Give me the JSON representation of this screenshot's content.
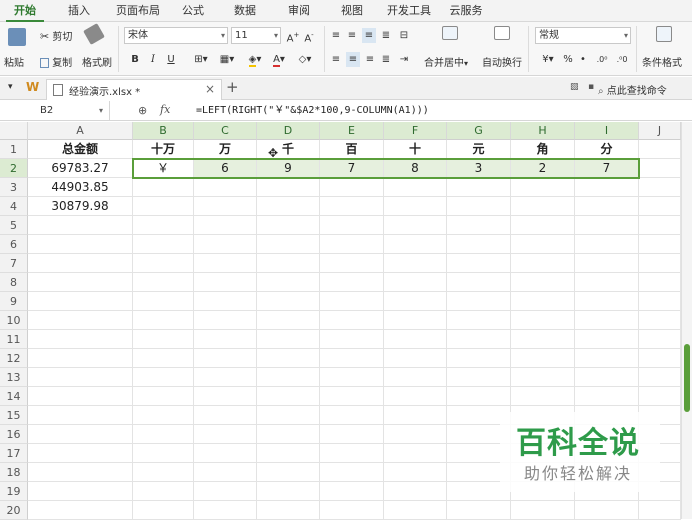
{
  "menu": {
    "tabs": [
      {
        "label": "开始",
        "active": true
      },
      {
        "label": "插入"
      },
      {
        "label": "页面布局"
      },
      {
        "label": "公式"
      },
      {
        "label": "数据"
      },
      {
        "label": "审阅"
      },
      {
        "label": "视图"
      },
      {
        "label": "开发工具"
      },
      {
        "label": "云服务"
      }
    ]
  },
  "ribbon": {
    "paste": "粘贴",
    "cut": "剪切",
    "copy": "复制",
    "format_painter": "格式刷",
    "font_name": "宋体",
    "font_size": "11",
    "bold": "B",
    "italic": "I",
    "underline": "U",
    "merge_center": "合并居中",
    "wrap_text": "自动换行",
    "number_format": "常规",
    "percent": "%",
    "comma": "•",
    "conditional_format": "条件格式",
    "accent_color": "#3a8a3a"
  },
  "docbar": {
    "filename": "经验演示.xlsx *",
    "close": "×",
    "add": "+",
    "find_command": "点此查找命令"
  },
  "formula_bar": {
    "name_box": "B2",
    "fx": "fx",
    "formula": "=LEFT(RIGHT(\"￥\"&$A2*100,9-COLUMN(A1)))"
  },
  "sheet": {
    "columns": [
      "A",
      "B",
      "C",
      "D",
      "E",
      "F",
      "G",
      "H",
      "I",
      "J"
    ],
    "rows": [
      "1",
      "2",
      "3",
      "4",
      "5",
      "6",
      "7",
      "8",
      "9",
      "10",
      "11",
      "12",
      "13",
      "14",
      "15",
      "16",
      "17",
      "18",
      "19",
      "20"
    ],
    "header_row": [
      "总金额",
      "十万",
      "万",
      "千",
      "百",
      "十",
      "元",
      "角",
      "分"
    ],
    "data": [
      [
        "69783.27",
        "￥",
        "6",
        "9",
        "7",
        "8",
        "3",
        "2",
        "7"
      ],
      [
        "44903.85",
        "",
        "",
        "",
        "",
        "",
        "",
        "",
        ""
      ],
      [
        "30879.98",
        "",
        "",
        "",
        "",
        "",
        "",
        "",
        ""
      ]
    ],
    "selection_color": "#5a9e3a"
  },
  "watermark": {
    "title": "百科全说",
    "subtitle": "助你轻松解决"
  }
}
